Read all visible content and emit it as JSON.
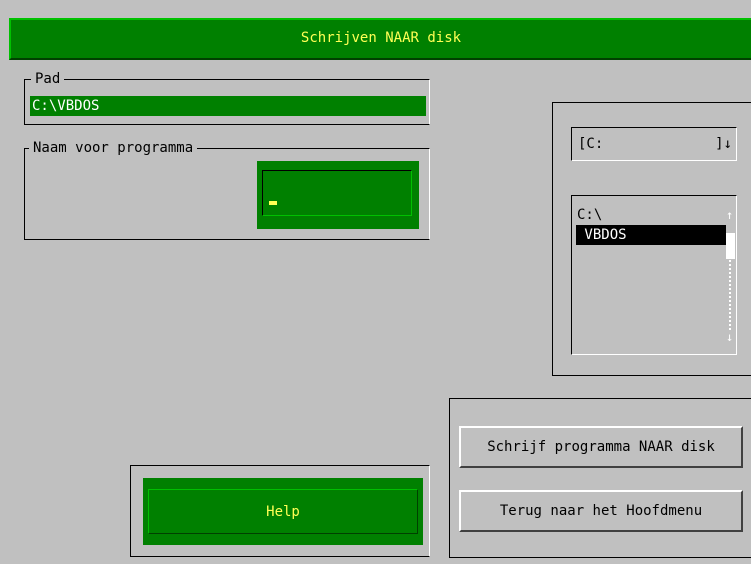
{
  "window": {
    "title": "Schrijven NAAR disk"
  },
  "path_group": {
    "legend": "Pad",
    "value": "C:\\VBDOS"
  },
  "name_group": {
    "legend": "Naam voor programma",
    "input_value": ""
  },
  "drive_select": {
    "value": "[C:",
    "arrow": "]↓"
  },
  "dir_list": {
    "items": [
      "C:\\",
      " VBDOS"
    ],
    "selected_index": 1
  },
  "buttons": {
    "help": "Help",
    "write": "Schrijf programma NAAR disk",
    "back": "Terug naar het Hoofdmenu"
  },
  "colors": {
    "accent": "#008000",
    "title_text": "#ffff55",
    "background": "#c0c0c0"
  }
}
